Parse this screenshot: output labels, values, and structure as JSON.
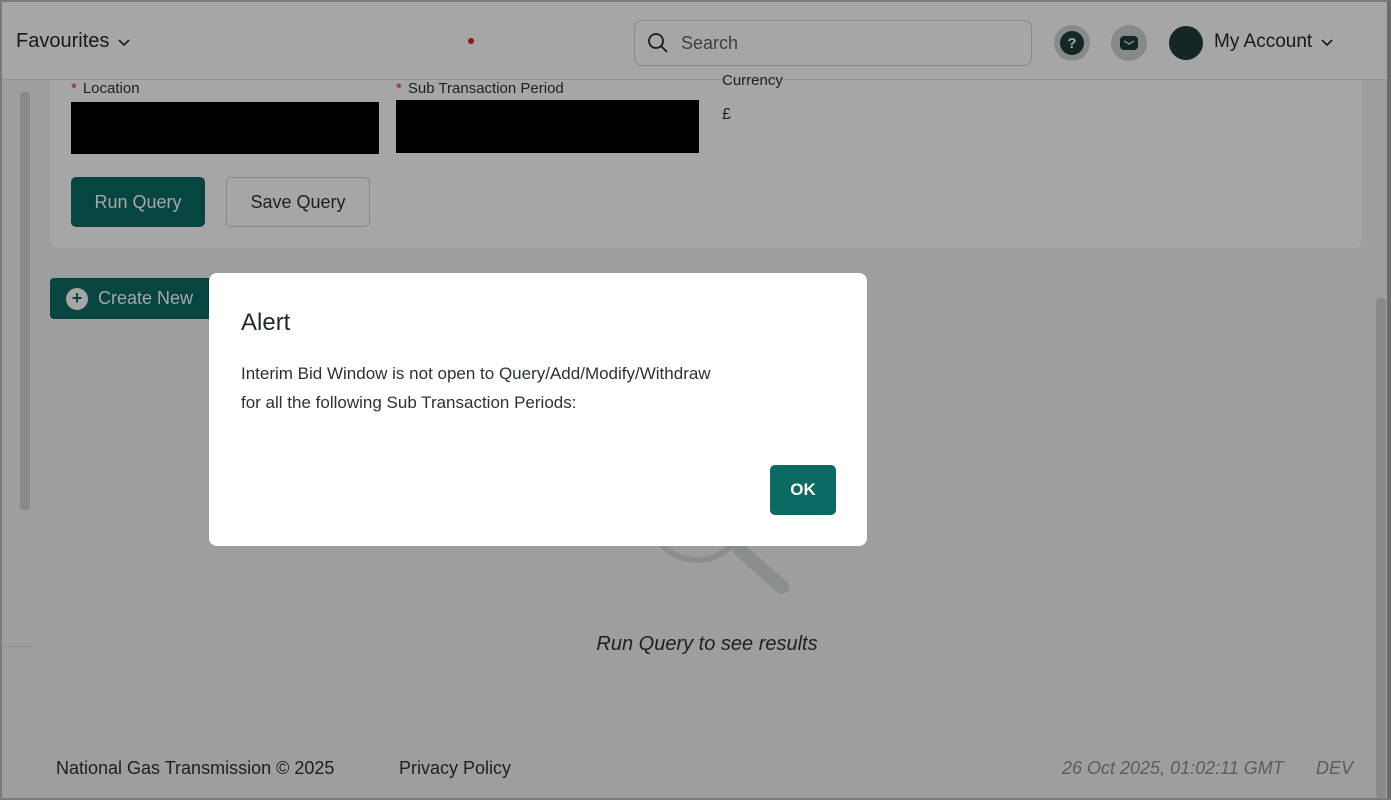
{
  "topbar": {
    "favourites_label": "Favourites",
    "search_placeholder": "Search",
    "help_icon_glyph": "?",
    "account_label": "My Account",
    "icons": [
      "chevron-down-icon",
      "search-icon",
      "help-icon",
      "mail-icon",
      "avatar"
    ]
  },
  "query_form": {
    "location_label": "Location",
    "sub_period_label": "Sub Transaction Period",
    "required_marker": "*",
    "currency_label": "Currency",
    "currency_value": "£",
    "run_query_label": "Run Query",
    "save_query_label": "Save Query"
  },
  "actions": {
    "create_new_label": "Create New"
  },
  "results": {
    "empty_message": "Run Query to see results"
  },
  "footer": {
    "copyright": "National Gas Transmission © 2025",
    "privacy_label": "Privacy Policy",
    "timestamp": "26 Oct 2025, 01:02:11 GMT",
    "environment": "DEV"
  },
  "alert": {
    "title": "Alert",
    "message_line1": "Interim Bid Window is not open to Query/Add/Modify/Withdraw",
    "message_line2": "for all the following Sub Transaction Periods:",
    "ok_label": "OK"
  },
  "colors": {
    "brand": "#0b6b63",
    "required": "#dd2222",
    "overlay": "rgba(0,0,0,0.35)"
  }
}
